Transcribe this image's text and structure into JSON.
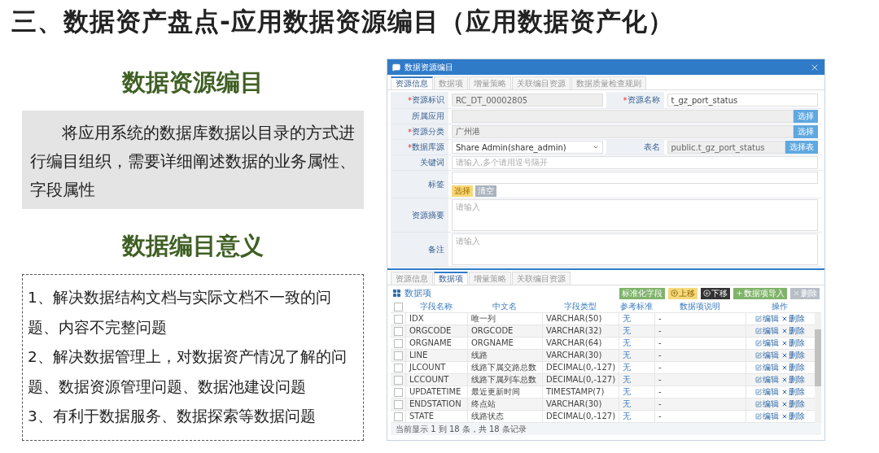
{
  "slide": {
    "title": "三、数据资产盘点-应用数据资源编目（应用数据资产化）",
    "section1": {
      "heading": "数据资源编目",
      "text": "将应用系统的数据库数据以目录的方式进行编目组织，需要详细阐述数据的业务属性、字段属性"
    },
    "section2": {
      "heading": "数据编目意义",
      "items": [
        "1、解决数据结构文档与实际文档不一致的问题、内容不完整问题",
        "2、解决数据管理上，对数据资产情况了解的问题、数据资源管理问题、数据池建设问题",
        "3、有利于数据服务、数据探索等数据问题"
      ]
    }
  },
  "window": {
    "title": "数据资源编目",
    "tabs": [
      {
        "label": "资源信息",
        "selected": true
      },
      {
        "label": "数据项",
        "selected": false
      },
      {
        "label": "增量策略",
        "selected": false
      },
      {
        "label": "关联编目资源",
        "selected": false
      },
      {
        "label": "数据质量检查规则",
        "selected": false
      }
    ],
    "form": [
      {
        "fields": [
          {
            "mark": "*",
            "label": "资源标识",
            "kind": "readonly",
            "value": "RC_DT_00002805"
          },
          {
            "mark": "*",
            "label": "资源名称",
            "kind": "text",
            "value": "t_gz_port_status"
          }
        ]
      },
      {
        "fields": [
          {
            "label": "所属应用",
            "kind": "picker",
            "button": "选择"
          }
        ]
      },
      {
        "fields": [
          {
            "mark": "*",
            "label": "资源分类",
            "kind": "picker",
            "value": "广州港",
            "button": "选择"
          }
        ]
      },
      {
        "fields": [
          {
            "mark": "*",
            "label": "数据库源",
            "kind": "select",
            "value": "Share Admin(share_admin)"
          },
          {
            "label": "表名",
            "kind": "picker",
            "value": "public.t_gz_port_status",
            "button": "选择表"
          }
        ]
      },
      {
        "fields": [
          {
            "label": "关键词",
            "kind": "text",
            "placeholder": "请输入,多个请用逗号隔开"
          }
        ]
      },
      {
        "fields": [
          {
            "label": "标签",
            "kind": "tags",
            "buttons": [
              "选择",
              "清空"
            ]
          }
        ]
      },
      {
        "fields": [
          {
            "label": "资源摘要",
            "kind": "textarea",
            "placeholder": "请输入"
          }
        ]
      },
      {
        "fields": [
          {
            "label": "备注",
            "kind": "textarea",
            "placeholder": "请输入"
          }
        ]
      }
    ],
    "lower_tabs": [
      {
        "label": "资源信息",
        "selected": false
      },
      {
        "label": "数据项",
        "selected": true
      },
      {
        "label": "增量策略",
        "selected": false
      },
      {
        "label": "关联编目资源",
        "selected": false
      }
    ],
    "section_title": "数据项",
    "toolbar": [
      {
        "label": "标准化字段",
        "kind": "plain",
        "color": "#7fb36a"
      },
      {
        "label": "上移",
        "kind": "up",
        "color": "#f5d97a"
      },
      {
        "label": "下移",
        "kind": "down",
        "color": "#333333"
      },
      {
        "label": "数据项导入",
        "kind": "add",
        "color": "#7fb36a"
      },
      {
        "label": "删除",
        "kind": "remove",
        "color": "#b8bec6"
      }
    ],
    "table": {
      "header_checked": false,
      "columns": [
        "字段名称",
        "中文名",
        "字段类型",
        "参考标准",
        "数据项说明",
        "操作"
      ],
      "rows": [
        {
          "checked": false,
          "cells": [
            "IDX",
            "唯一列",
            "VARCHAR(50)",
            "无",
            "-"
          ],
          "actions": [
            "编辑",
            "删除"
          ]
        },
        {
          "checked": false,
          "cells": [
            "ORGCODE",
            "ORGCODE",
            "VARCHAR(32)",
            "无",
            "-"
          ],
          "actions": [
            "编辑",
            "删除"
          ]
        },
        {
          "checked": false,
          "cells": [
            "ORGNAME",
            "ORGNAME",
            "VARCHAR(64)",
            "无",
            "-"
          ],
          "actions": [
            "编辑",
            "删除"
          ]
        },
        {
          "checked": false,
          "cells": [
            "LINE",
            "线路",
            "VARCHAR(30)",
            "无",
            "-"
          ],
          "actions": [
            "编辑",
            "删除"
          ]
        },
        {
          "checked": false,
          "cells": [
            "JLCOUNT",
            "线路下属交路总数",
            "DECIMAL(0,-127)",
            "无",
            "-"
          ],
          "actions": [
            "编辑",
            "删除"
          ]
        },
        {
          "checked": false,
          "cells": [
            "LCCOUNT",
            "线路下属列车总数",
            "DECIMAL(0,-127)",
            "无",
            "-"
          ],
          "actions": [
            "编辑",
            "删除"
          ]
        },
        {
          "checked": false,
          "cells": [
            "UPDATETIME",
            "最近更新时间",
            "TIMESTAMP(7)",
            "无",
            "-"
          ],
          "actions": [
            "编辑",
            "删除"
          ]
        },
        {
          "checked": false,
          "cells": [
            "ENDSTATION",
            "终点站",
            "VARCHAR(30)",
            "无",
            "-"
          ],
          "actions": [
            "编辑",
            "删除"
          ]
        },
        {
          "checked": false,
          "cells": [
            "STATE",
            "线路状态",
            "DECIMAL(0,-127)",
            "无",
            "-"
          ],
          "actions": [
            "编辑",
            "删除"
          ]
        }
      ],
      "footer": "当前显示 1 到 18 条，共 18 条记录"
    }
  }
}
